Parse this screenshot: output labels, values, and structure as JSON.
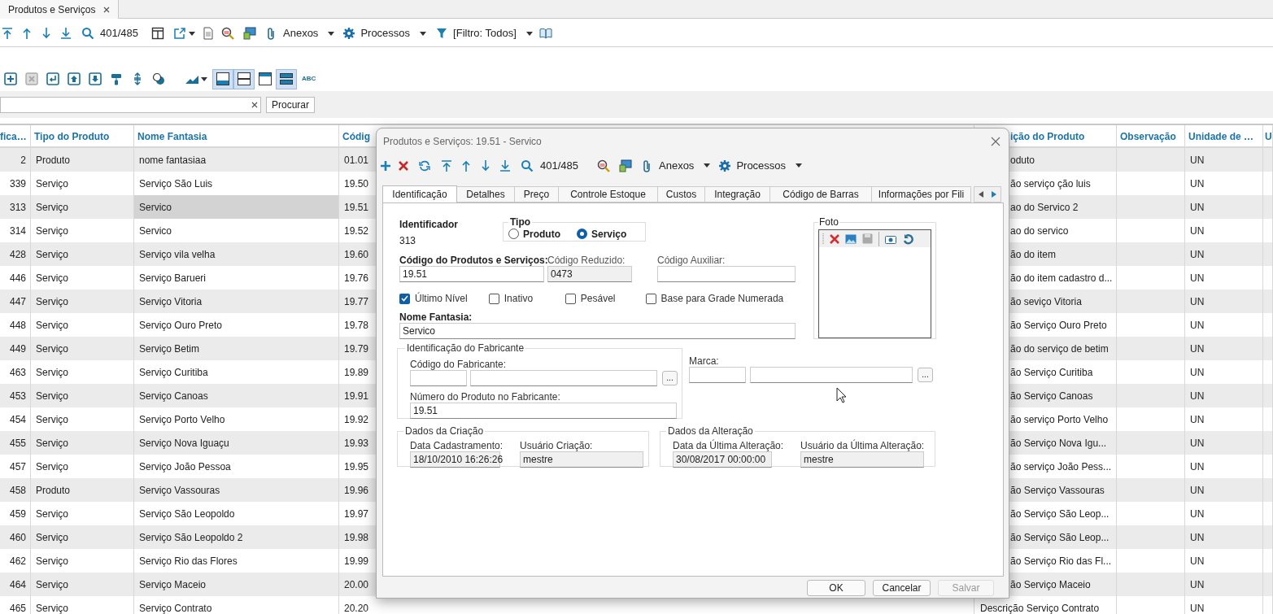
{
  "tabs": [
    {
      "label": "Produtos e Serviços",
      "selected": true
    }
  ],
  "toolbar": {
    "counter": "401/485",
    "attachments": "Anexos",
    "processes": "Processos",
    "filter": "[Filtro: Todos]"
  },
  "toolbar2": {
    "toggles": [
      {
        "selected": true
      },
      {
        "selected": true
      },
      {
        "selected": false
      },
      {
        "selected": true
      }
    ],
    "spell": "ABC"
  },
  "search": {
    "button": "Procurar"
  },
  "table": {
    "columns": [
      "fica…",
      "Tipo do Produto",
      "Nome Fantasia",
      "Códig",
      "ição do Produto",
      "Observação",
      "Unidade de …",
      "U"
    ],
    "rows": [
      {
        "id": "2",
        "type": "Produto",
        "name": "nome fantasiaa",
        "code": "01.01",
        "description": "oduto",
        "unit": "UN",
        "selected": false
      },
      {
        "id": "339",
        "type": "Serviço",
        "name": "Serviço São Luis",
        "code": "19.50",
        "description": "ão serviço ção luis",
        "unit": "UN",
        "selected": false
      },
      {
        "id": "313",
        "type": "Serviço",
        "name": "Servico",
        "code": "19.51",
        "description": "ao do Servico 2",
        "unit": "UN",
        "selected": true
      },
      {
        "id": "314",
        "type": "Serviço",
        "name": "Servico",
        "code": "19.52",
        "description": "ao do servico",
        "unit": "UN",
        "selected": false
      },
      {
        "id": "428",
        "type": "Serviço",
        "name": "Serviço vila velha",
        "code": "19.60",
        "description": "ão do item",
        "unit": "UN",
        "selected": false
      },
      {
        "id": "446",
        "type": "Serviço",
        "name": "Serviço Barueri",
        "code": "19.76",
        "description": "ão do item cadastro d...",
        "unit": "UN",
        "selected": false
      },
      {
        "id": "447",
        "type": "Serviço",
        "name": "Serviço Vitoria",
        "code": "19.77",
        "description": "ão seviço Vitoria",
        "unit": "UN",
        "selected": false
      },
      {
        "id": "448",
        "type": "Serviço",
        "name": "Serviço Ouro Preto",
        "code": "19.78",
        "description": "ão Serviço Ouro Preto",
        "unit": "UN",
        "selected": false
      },
      {
        "id": "449",
        "type": "Serviço",
        "name": "Serviço Betim",
        "code": "19.79",
        "description": "ão do serviço de betim",
        "unit": "UN",
        "selected": false
      },
      {
        "id": "463",
        "type": "Serviço",
        "name": "Serviço Curitiba",
        "code": "19.89",
        "description": "ão Serviço Curitiba",
        "unit": "UN",
        "selected": false
      },
      {
        "id": "453",
        "type": "Serviço",
        "name": "Serviço Canoas",
        "code": "19.91",
        "description": "ão Serviço Canoas",
        "unit": "UN",
        "selected": false
      },
      {
        "id": "454",
        "type": "Serviço",
        "name": "Serviço Porto Velho",
        "code": "19.92",
        "description": "ão serviço Porto Velho",
        "unit": "UN",
        "selected": false
      },
      {
        "id": "455",
        "type": "Serviço",
        "name": "Serviço Nova Iguaçu",
        "code": "19.93",
        "description": "ão Serviço Nova Igu...",
        "unit": "UN",
        "selected": false
      },
      {
        "id": "457",
        "type": "Serviço",
        "name": "Serviço João Pessoa",
        "code": "19.95",
        "description": "ão serviço João Pess...",
        "unit": "UN",
        "selected": false
      },
      {
        "id": "458",
        "type": "Produto",
        "name": "Serviço Vassouras",
        "code": "19.96",
        "description": "ão Serviço Vassouras",
        "unit": "UN",
        "selected": false
      },
      {
        "id": "459",
        "type": "Serviço",
        "name": "Serviço São Leopoldo",
        "code": "19.97",
        "description": "ão Serviço São Leop...",
        "unit": "UN",
        "selected": false
      },
      {
        "id": "460",
        "type": "Serviço",
        "name": "Serviço São Leopoldo 2",
        "code": "19.98",
        "description": "ão Serviço São Leop...",
        "unit": "UN",
        "selected": false
      },
      {
        "id": "462",
        "type": "Serviço",
        "name": "Serviço Rio das Flores",
        "code": "19.99",
        "description": "ão Serviço Rio das Fl...",
        "unit": "UN",
        "selected": false
      },
      {
        "id": "464",
        "type": "Serviço",
        "name": "Serviço Maceio",
        "code": "20.00",
        "description": "ão Serviço Maceio",
        "unit": "UN",
        "selected": false
      },
      {
        "id": "465",
        "type": "Serviço",
        "name": "Serviço Contrato",
        "code": "20.20",
        "description": "Descrição Serviço Contrato",
        "unit": "UN",
        "selected": false
      }
    ]
  },
  "dialog": {
    "title": "Produtos e Serviços: 19.51 - Servico",
    "counter": "401/485",
    "attachments": "Anexos",
    "processes": "Processos",
    "tabs": [
      {
        "label": "Identificação",
        "selected": true
      },
      {
        "label": "Detalhes",
        "selected": false
      },
      {
        "label": "Preço",
        "selected": false
      },
      {
        "label": "Controle Estoque",
        "selected": false
      },
      {
        "label": "Custos",
        "selected": false
      },
      {
        "label": "Integração",
        "selected": false
      },
      {
        "label": "Código de Barras",
        "selected": false
      },
      {
        "label": "Informações por Fili",
        "selected": false
      }
    ],
    "identifier": {
      "label": "Identificador",
      "value": "313"
    },
    "type_group": {
      "label": "Tipo",
      "options": [
        {
          "label": "Produto",
          "selected": false
        },
        {
          "label": "Serviço",
          "selected": true
        }
      ]
    },
    "code": {
      "label": "Código do Produtos e Serviços:",
      "value": "19.51"
    },
    "short_code": {
      "label": "Código Reduzido:",
      "value": "0473"
    },
    "aux_code": {
      "label": "Código Auxiliar:"
    },
    "checkboxes": [
      {
        "label": "Último Nível",
        "checked": true
      },
      {
        "label": "Inativo",
        "checked": false
      },
      {
        "label": "Pesável",
        "checked": false
      },
      {
        "label": "Base para Grade Numerada",
        "checked": false
      }
    ],
    "trade_name": {
      "label": "Nome Fantasia:",
      "value": "Servico"
    },
    "photo": {
      "label": "Foto"
    },
    "manufacturer": {
      "label": "Identificação do Fabricante",
      "code_label": "Código do Fabricante:",
      "browse": "...",
      "number_label": "Número do Produto no Fabricante:",
      "number": "19.51"
    },
    "brand": {
      "label": "Marca:",
      "browse": "..."
    },
    "creation": {
      "label": "Dados da Criação",
      "date_label": "Data Cadastramento:",
      "date": "18/10/2010 16:26:26",
      "user_label": "Usuário Criação:",
      "user": "mestre"
    },
    "change": {
      "label": "Dados da Alteração",
      "date_label": "Data da Última Alteração:",
      "date": "30/08/2017 00:00:00",
      "user_label": "Usuário da Última Alteração:",
      "user": "mestre"
    },
    "buttons": [
      {
        "label": "OK",
        "disabled": false
      },
      {
        "label": "Cancelar",
        "disabled": false
      },
      {
        "label": "Salvar",
        "disabled": true
      }
    ]
  }
}
